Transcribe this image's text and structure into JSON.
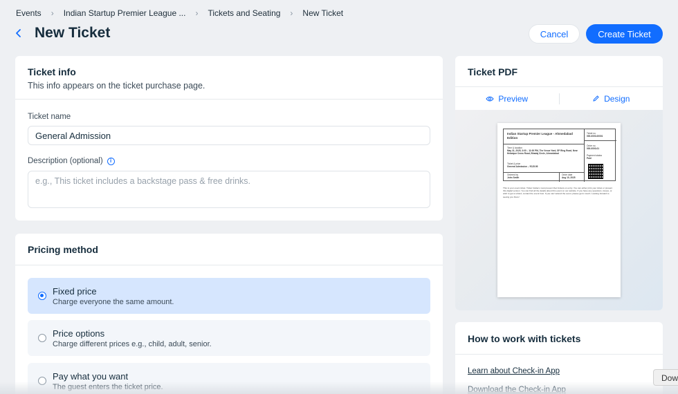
{
  "breadcrumb": {
    "items": [
      "Events",
      "Indian Startup Premier League ...",
      "Tickets and Seating",
      "New Ticket"
    ]
  },
  "header": {
    "title": "New Ticket",
    "cancel_label": "Cancel",
    "create_label": "Create Ticket"
  },
  "ticket_info": {
    "title": "Ticket info",
    "subtitle": "This info appears on the ticket purchase page.",
    "name_label": "Ticket name",
    "name_value": "General Admission",
    "description_label": "Description (optional)",
    "description_placeholder": "e.g., This ticket includes a backstage pass & free drinks."
  },
  "pricing": {
    "title": "Pricing method",
    "options": [
      {
        "title": "Fixed price",
        "subtitle": "Charge everyone the same amount.",
        "selected": true
      },
      {
        "title": "Price options",
        "subtitle": "Charge different prices e.g., child, adult, senior.",
        "selected": false
      },
      {
        "title": "Pay what you want",
        "subtitle": "The guest enters the ticket price.",
        "selected": false
      }
    ]
  },
  "pdf": {
    "title": "Ticket PDF",
    "preview_label": "Preview",
    "design_label": "Design",
    "ticket": {
      "event_name": "Indian Startup Premier League - Ahmedabad Edition",
      "time_location_label": "Time & location",
      "time_location_value": "May 31, 2025, 3:00 – 11:00 PM, The Venue Yard, SP Ring Road, Near Hebatpur Cross Road, Bhadaj Circle, Ahmedabad",
      "ticket_price_label": "Ticket & price",
      "ticket_price_value": "General Admission – ₹125.95",
      "ordered_by_label": "Ordered by",
      "ordered_by_value": "John Smith",
      "order_date_label": "Order date",
      "order_date_value": "Aug 10, 2025",
      "ticket_no_label": "Ticket no.",
      "ticket_no_value": "000-0000-00001",
      "order_no_label": "Order no.",
      "order_no_value": "000-0000-01",
      "payment_status_label": "Payment status",
      "payment_status_value": "Paid",
      "note": "This is your event ticket. Ticket holders must present their tickets on entry. You can either print your ticket or present this digital version. You can find all the details about this event on our website. If you have any questions, issues, or wish to get a refund, contact the event host. If you can't attend the event, please get in touch. Looking forward to seeing you there!"
    }
  },
  "how": {
    "title": "How to work with tickets",
    "links": [
      "Learn about Check-in App",
      "Download the Check-in App"
    ]
  },
  "download_chip": "Dow"
}
